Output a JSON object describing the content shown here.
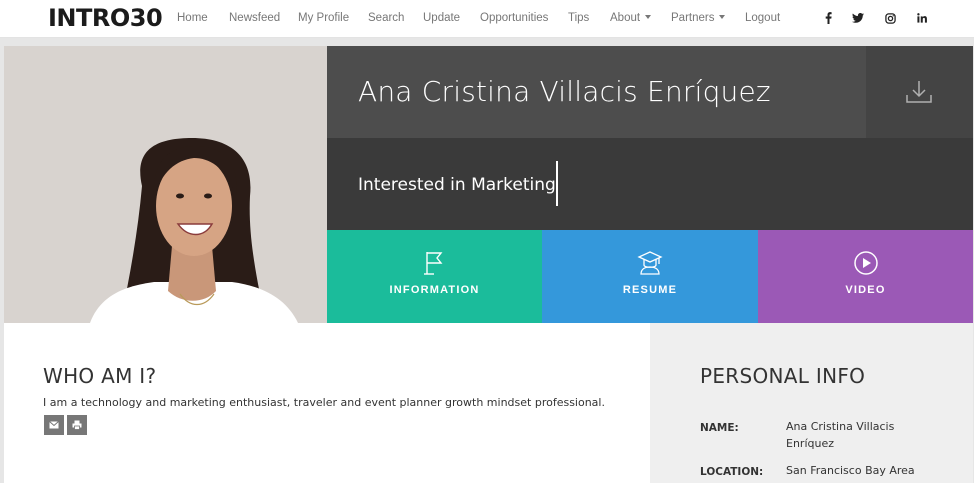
{
  "logo": "INTRO30",
  "nav": {
    "items": [
      "Home",
      "Newsfeed",
      "My Profile",
      "Search",
      "Update",
      "Opportunities",
      "Tips",
      "About",
      "Partners",
      "Logout"
    ],
    "social_icons": [
      "facebook-icon",
      "twitter-icon",
      "instagram-icon",
      "linkedin-icon"
    ]
  },
  "profile": {
    "name": "Ana Cristina Villacis Enríquez",
    "interest": "Interested in Marketing"
  },
  "tiles": [
    {
      "label": "INFORMATION",
      "color": "#1bbc9b",
      "icon": "flag-icon"
    },
    {
      "label": "RESUME",
      "color": "#3498db",
      "icon": "graduate-icon"
    },
    {
      "label": "VIDEO",
      "color": "#9b59b6",
      "icon": "play-icon"
    }
  ],
  "who": {
    "title": "WHO AM I?",
    "text": "I am a technology and marketing enthusiast, traveler and event planner growth mindset professional."
  },
  "personal_info": {
    "title": "PERSONAL INFO",
    "name_label": "NAME:",
    "name_value": "Ana Cristina Villacis Enríquez",
    "location_label": "LOCATION:",
    "location_value": "San Francisco Bay Area"
  },
  "colors": {
    "name_bg": "#4d4d4d",
    "interest_bg": "#3a3a3a",
    "info_tile": "#1bbc9b",
    "resume_tile": "#3498db",
    "video_tile": "#9b59b6"
  }
}
